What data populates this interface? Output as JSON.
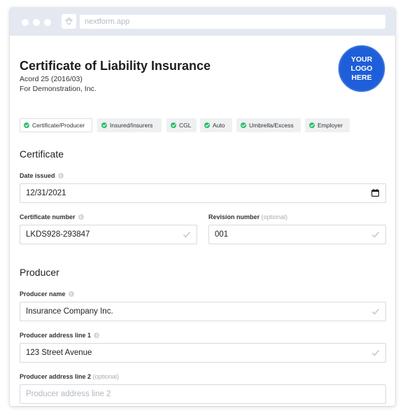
{
  "browser": {
    "url": "nextform.app"
  },
  "header": {
    "title": "Certificate of Liability Insurance",
    "form_code": "Acord 25 (2016/03)",
    "company": "For Demonstration, Inc.",
    "logo_lines": [
      "YOUR",
      "LOGO",
      "HERE"
    ],
    "logo_color": "#1e5ed8"
  },
  "tabs": [
    {
      "label": "Certificate/Producer",
      "active": true
    },
    {
      "label": "Insured/Insurers",
      "active": false
    },
    {
      "label": "CGL",
      "active": false
    },
    {
      "label": "Auto",
      "active": false
    },
    {
      "label": "Umbrella/Excess",
      "active": false
    },
    {
      "label": "Employer",
      "active": false
    }
  ],
  "certificate": {
    "section_title": "Certificate",
    "date_issued": {
      "label": "Date issued",
      "value": "12/31/2021"
    },
    "certificate_number": {
      "label": "Certificate number",
      "value": "LKDS928-293847"
    },
    "revision_number": {
      "label": "Revision number",
      "optional": "(optional)",
      "value": "001"
    }
  },
  "producer": {
    "section_title": "Producer",
    "name": {
      "label": "Producer name",
      "value": "Insurance Company Inc."
    },
    "address1": {
      "label": "Producer address line 1",
      "value": "123 Street Avenue"
    },
    "address2": {
      "label": "Producer address line 2",
      "optional": "(optional)",
      "placeholder": "Producer address line 2"
    }
  },
  "colors": {
    "check_green": "#2ebd6b",
    "titlebar": "#e4e9f1"
  }
}
